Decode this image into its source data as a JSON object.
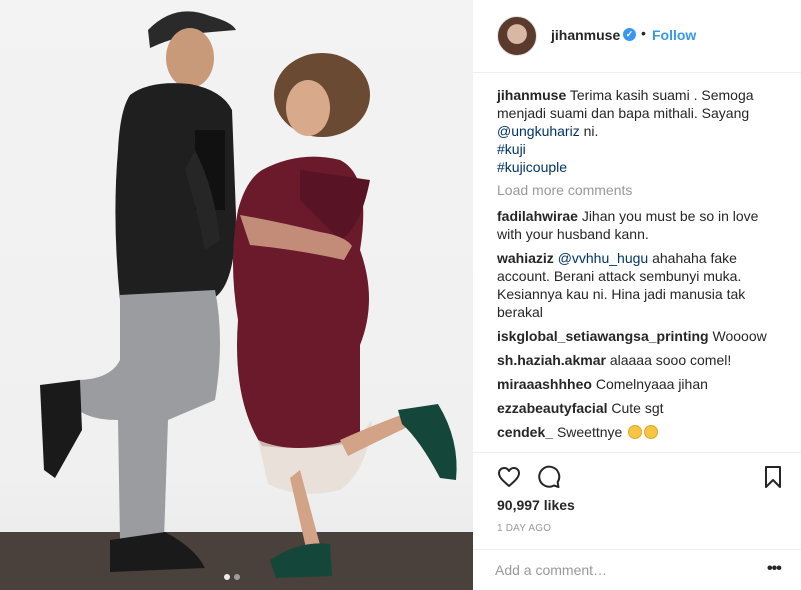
{
  "post": {
    "username": "jihanmuse",
    "verified_icon": "verified-badge-icon",
    "separator": "•",
    "follow_label": "Follow",
    "caption": {
      "username": "jihanmuse",
      "line1": "Terima kasih suami . Semoga",
      "line2": "menjadi suami dan bapa mithali. Sayang",
      "mention": "@ungkuhariz",
      "mention_suffix": " ni.",
      "tags": [
        "#kuji",
        "#kujicouple"
      ]
    },
    "load_more": "Load more comments",
    "comments": [
      {
        "user": "fadilahwirae",
        "text": "Jihan you must be so in love with your husband kann."
      },
      {
        "user": "wahiaziz",
        "mention": "@vvhhu_hugu",
        "text": "ahahaha fake account. Berani attack sembunyi muka. Kesiannya kau ni. Hina jadi manusia tak berakal"
      },
      {
        "user": "iskglobal_setiawangsa_printing",
        "text": "Woooow"
      },
      {
        "user": "sh.haziah.akmar",
        "text": "alaaaa sooo comel!"
      },
      {
        "user": "miraaashhheo",
        "text": "Comelnyaaa jihan"
      },
      {
        "user": "ezzabeautyfacial",
        "text": "Cute sgt"
      },
      {
        "user": "cendek_",
        "text": "Sweettnye"
      }
    ],
    "likes": "90,997 likes",
    "timestamp": "1 DAY AGO",
    "add_comment_placeholder": "Add a comment…",
    "more_label": "•••",
    "carousel": {
      "count": 2,
      "active": 0
    }
  },
  "icons": {
    "like": "heart-icon",
    "comment": "comment-icon",
    "save": "bookmark-icon",
    "more": "more-options-icon"
  },
  "colors": {
    "link_blue": "#3897f0",
    "tag_blue": "#003569",
    "muted": "#999999",
    "text": "#262626",
    "dress": "#6b1a2c"
  }
}
